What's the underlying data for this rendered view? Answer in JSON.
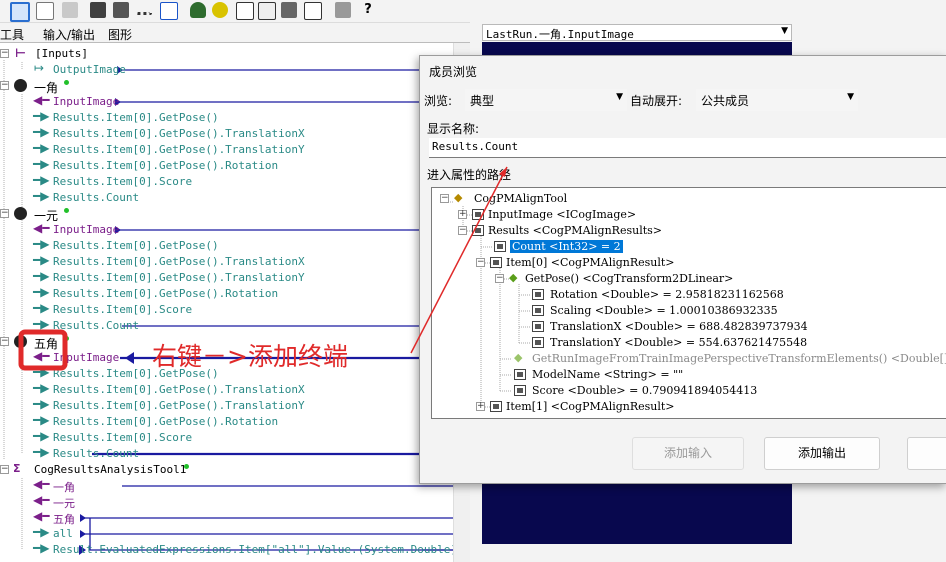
{
  "tabs": {
    "tools": "工具",
    "io": "输入/输出",
    "graphics": "图形"
  },
  "tree": {
    "inputs": "[Inputs]",
    "output_image": "OutputImage",
    "yijiao": "一角",
    "yiyuan": "一元",
    "wujiao": "五角",
    "input_image": "InputImage",
    "getpose": "Results.Item[0].GetPose()",
    "translation_x": "Results.Item[0].GetPose().TranslationX",
    "translation_y": "Results.Item[0].GetPose().TranslationY",
    "rotation": "Results.Item[0].GetPose().Rotation",
    "score": "Results.Item[0].Score",
    "count": "Results.Count",
    "analysis_tool": "CogResultsAnalysisTool1",
    "all": "all",
    "result_expr": "Result.EvaluatedExpressions.Item[\"all\"].Value.(System.Double)"
  },
  "annotation": "右键－>添加终端",
  "right_panel": {
    "image_combo": "LastRun.一角.InputImage"
  },
  "dialog": {
    "title": "成员浏览",
    "browse_label": "浏览:",
    "browse_value": "典型",
    "auto_expand_label": "自动展开:",
    "auto_expand_value": "公共成员",
    "display_name_label": "显示名称:",
    "display_name_value": "Results.Count",
    "path_label": "进入属性的路径",
    "tree": {
      "root": "CogPMAlignTool",
      "input_image": "InputImage <ICogImage>",
      "results": "Results <CogPMAlignResults>",
      "count": "Count <Int32> = 2",
      "item0": "Item[0] <CogPMAlignResult>",
      "getpose": "GetPose() <CogTransform2DLinear>",
      "rotation": "Rotation <Double> = 2.95818231162568",
      "scaling": "Scaling <Double> = 1.00010386932335",
      "translation_x": "TranslationX <Double> = 688.482839737934",
      "translation_y": "TranslationY <Double> = 554.637621475548",
      "get_run_image": "GetRunImageFromTrainImagePerspectiveTransformElements() <Double[]> =",
      "model_name": "ModelName <String> = \"\"",
      "score": "Score <Double> = 0.790941894054413",
      "item1": "Item[1] <CogPMAlignResult>"
    },
    "buttons": {
      "add_input": "添加输入",
      "add_output": "添加输出"
    }
  },
  "colors": {
    "highlight": "#0078d7",
    "annotation_red": "#e02a2a",
    "wire_blue": "#1a1aa0",
    "image_bg": "#08084e"
  }
}
